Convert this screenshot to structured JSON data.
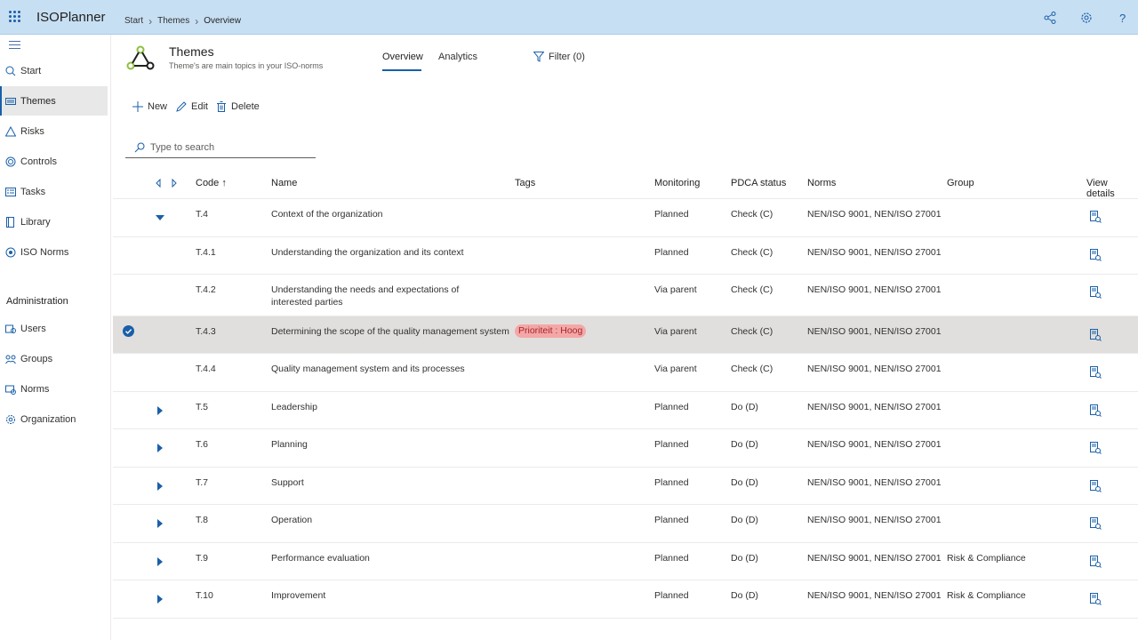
{
  "app": {
    "title": "ISOPlanner"
  },
  "breadcrumb": [
    "Start",
    "Themes",
    "Overview"
  ],
  "sidebar": {
    "items": [
      {
        "label": "Start",
        "icon": "home-icon",
        "active": false
      },
      {
        "label": "Themes",
        "icon": "list-icon",
        "active": true
      },
      {
        "label": "Risks",
        "icon": "warning-icon",
        "active": false
      },
      {
        "label": "Controls",
        "icon": "target-icon",
        "active": false
      },
      {
        "label": "Tasks",
        "icon": "tasks-icon",
        "active": false
      },
      {
        "label": "Library",
        "icon": "library-icon",
        "active": false
      },
      {
        "label": "ISO Norms",
        "icon": "norms-icon",
        "active": false
      }
    ],
    "admin_label": "Administration",
    "admin_items": [
      {
        "label": "Users",
        "icon": "users-icon"
      },
      {
        "label": "Groups",
        "icon": "groups-icon"
      },
      {
        "label": "Norms",
        "icon": "norms-admin-icon"
      },
      {
        "label": "Organization",
        "icon": "gear-icon"
      }
    ]
  },
  "header": {
    "title": "Themes",
    "subtitle": "Theme's are main topics in your ISO-norms",
    "tabs": [
      {
        "label": "Overview",
        "active": true
      },
      {
        "label": "Analytics",
        "active": false
      }
    ],
    "filter_label": "Filter (0)"
  },
  "commands": {
    "new": "New",
    "edit": "Edit",
    "delete": "Delete"
  },
  "search": {
    "placeholder": "Type to search"
  },
  "table": {
    "columns": {
      "code": "Code ↑",
      "name": "Name",
      "tags": "Tags",
      "monitoring": "Monitoring",
      "pdca": "PDCA status",
      "norms": "Norms",
      "group": "Group",
      "details": "View details"
    },
    "rows": [
      {
        "code": "T.4",
        "name": "Context of the organization",
        "tag": "",
        "monitoring": "Planned",
        "pdca": "Check (C)",
        "norms": "NEN/ISO 9001, NEN/ISO 27001",
        "group": "",
        "expander": "down",
        "selected": false
      },
      {
        "code": "T.4.1",
        "name": "Understanding the organization and its context",
        "tag": "",
        "monitoring": "Planned",
        "pdca": "Check (C)",
        "norms": "NEN/ISO 9001, NEN/ISO 27001",
        "group": "",
        "expander": "none",
        "selected": false
      },
      {
        "code": "T.4.2",
        "name": "Understanding the needs and expectations of interested parties",
        "tag": "",
        "monitoring": "Via parent",
        "pdca": "Check (C)",
        "norms": "NEN/ISO 9001, NEN/ISO 27001",
        "group": "",
        "expander": "none",
        "selected": false
      },
      {
        "code": "T.4.3",
        "name": "Determining the scope of the quality management system",
        "tag": "Prioriteit : Hoog",
        "monitoring": "Via parent",
        "pdca": "Check (C)",
        "norms": "NEN/ISO 9001, NEN/ISO 27001",
        "group": "",
        "expander": "none",
        "selected": true
      },
      {
        "code": "T.4.4",
        "name": "Quality management system and its processes",
        "tag": "",
        "monitoring": "Via parent",
        "pdca": "Check (C)",
        "norms": "NEN/ISO 9001, NEN/ISO 27001",
        "group": "",
        "expander": "none",
        "selected": false
      },
      {
        "code": "T.5",
        "name": "Leadership",
        "tag": "",
        "monitoring": "Planned",
        "pdca": "Do (D)",
        "norms": "NEN/ISO 9001, NEN/ISO 27001",
        "group": "",
        "expander": "right",
        "selected": false
      },
      {
        "code": "T.6",
        "name": "Planning",
        "tag": "",
        "monitoring": "Planned",
        "pdca": "Do (D)",
        "norms": "NEN/ISO 9001, NEN/ISO 27001",
        "group": "",
        "expander": "right",
        "selected": false
      },
      {
        "code": "T.7",
        "name": "Support",
        "tag": "",
        "monitoring": "Planned",
        "pdca": "Do (D)",
        "norms": "NEN/ISO 9001, NEN/ISO 27001",
        "group": "",
        "expander": "right",
        "selected": false
      },
      {
        "code": "T.8",
        "name": "Operation",
        "tag": "",
        "monitoring": "Planned",
        "pdca": "Do (D)",
        "norms": "NEN/ISO 9001, NEN/ISO 27001",
        "group": "",
        "expander": "right",
        "selected": false
      },
      {
        "code": "T.9",
        "name": "Performance evaluation",
        "tag": "",
        "monitoring": "Planned",
        "pdca": "Do (D)",
        "norms": "NEN/ISO 9001, NEN/ISO 27001",
        "group": "Risk & Compliance",
        "expander": "right",
        "selected": false
      },
      {
        "code": "T.10",
        "name": "Improvement",
        "tag": "",
        "monitoring": "Planned",
        "pdca": "Do (D)",
        "norms": "NEN/ISO 9001, NEN/ISO 27001",
        "group": "Risk & Compliance",
        "expander": "right",
        "selected": false
      }
    ]
  },
  "colors": {
    "accent": "#1a5fa8",
    "topbar": "#c7dff3",
    "tag_bg": "#f4a7a7",
    "tag_text": "#a4262c"
  }
}
